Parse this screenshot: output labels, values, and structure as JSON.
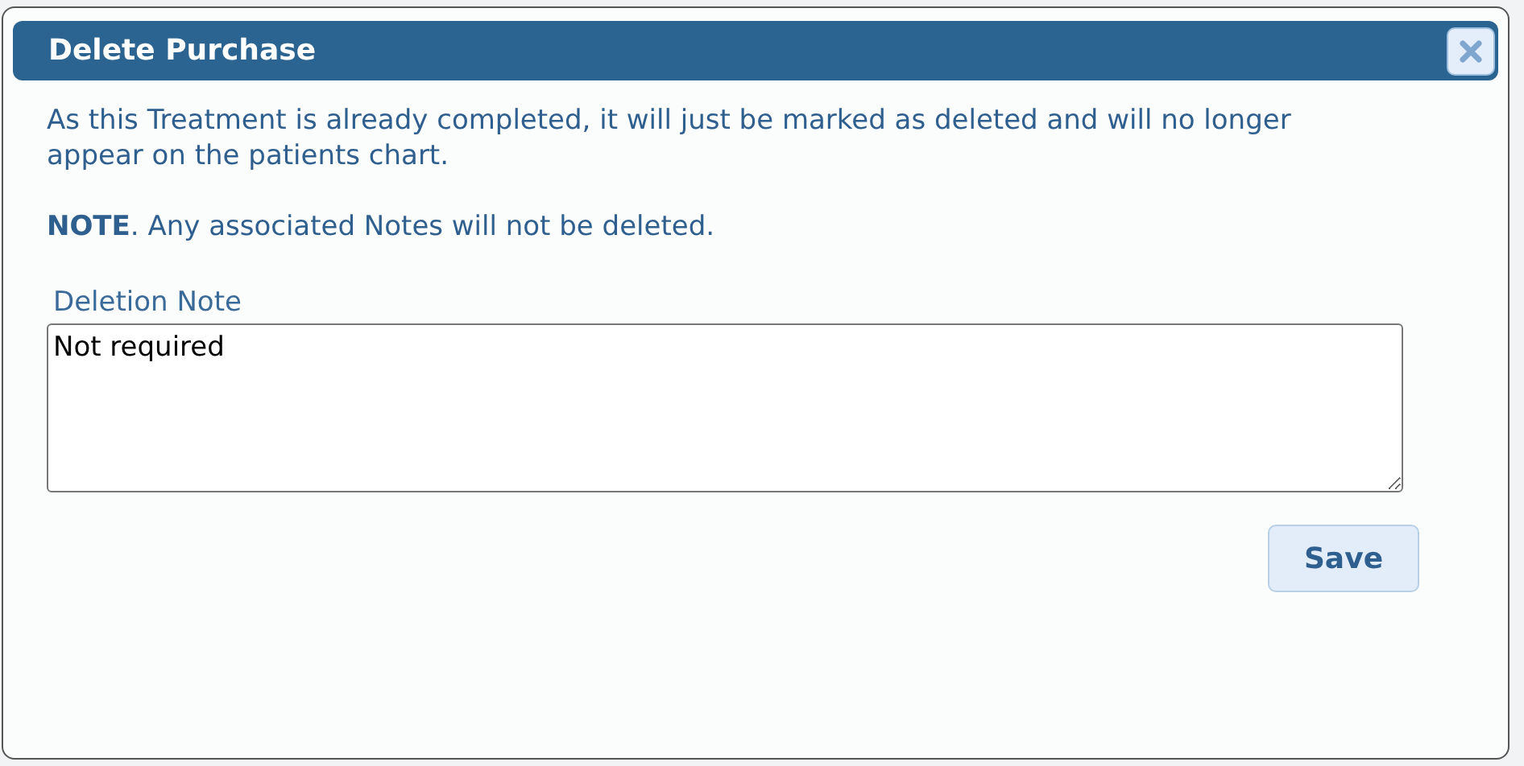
{
  "dialog": {
    "title": "Delete Purchase",
    "message": "As this Treatment is already completed, it will just be marked as deleted and will no longer appear on the patients chart.",
    "note": "**NOTE**. Any associated Notes will not be deleted.",
    "field": {
      "label": "Deletion Note",
      "value": "Not required"
    },
    "buttons": [
      "Save"
    ]
  }
}
